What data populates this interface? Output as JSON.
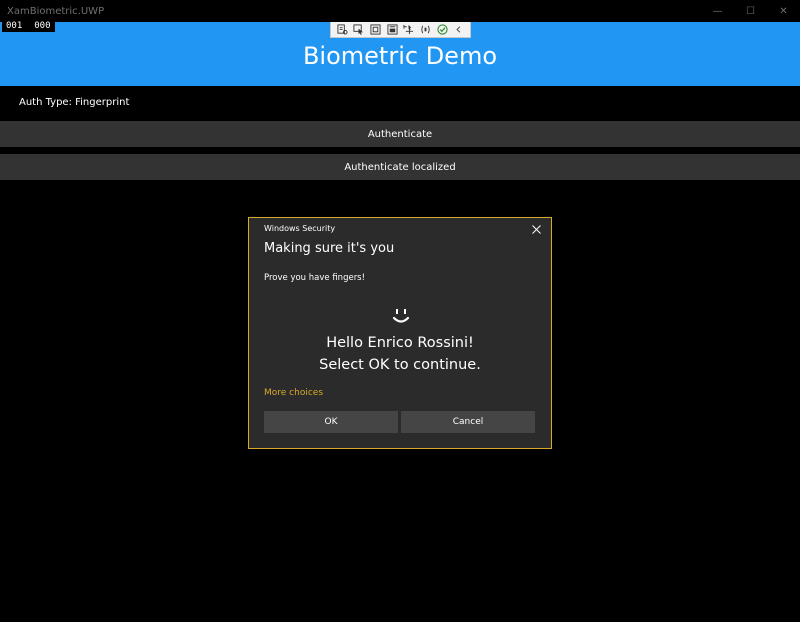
{
  "window": {
    "title": "XamBiometric.UWP",
    "minimize_glyph": "—",
    "maximize_glyph": "☐",
    "close_glyph": "✕"
  },
  "debug_counter": {
    "a": "001",
    "b": "000"
  },
  "dev_toolbar": {
    "icons": [
      "live-visual-tree-icon",
      "select-element-icon",
      "display-layout-adorners-icon",
      "track-focus-icon",
      "preview-selection-icon",
      "binding-failures-icon",
      "accessibility-check-icon",
      "collapse-toolbar-icon"
    ]
  },
  "app": {
    "title": "Biometric Demo",
    "header_color": "#2196f3",
    "auth_type": "Auth Type: Fingerprint",
    "buttons": {
      "authenticate": "Authenticate",
      "authenticate_localized": "Authenticate localized"
    }
  },
  "dialog": {
    "app_name": "Windows Security",
    "heading": "Making sure it's you",
    "message": "Prove you have fingers!",
    "hello_line1": "Hello Enrico Rossini!",
    "hello_line2": "Select OK to continue.",
    "more_choices": "More choices",
    "ok_label": "OK",
    "cancel_label": "Cancel",
    "accent_color": "#d8a82a",
    "icon": "windows-hello-face-icon"
  }
}
